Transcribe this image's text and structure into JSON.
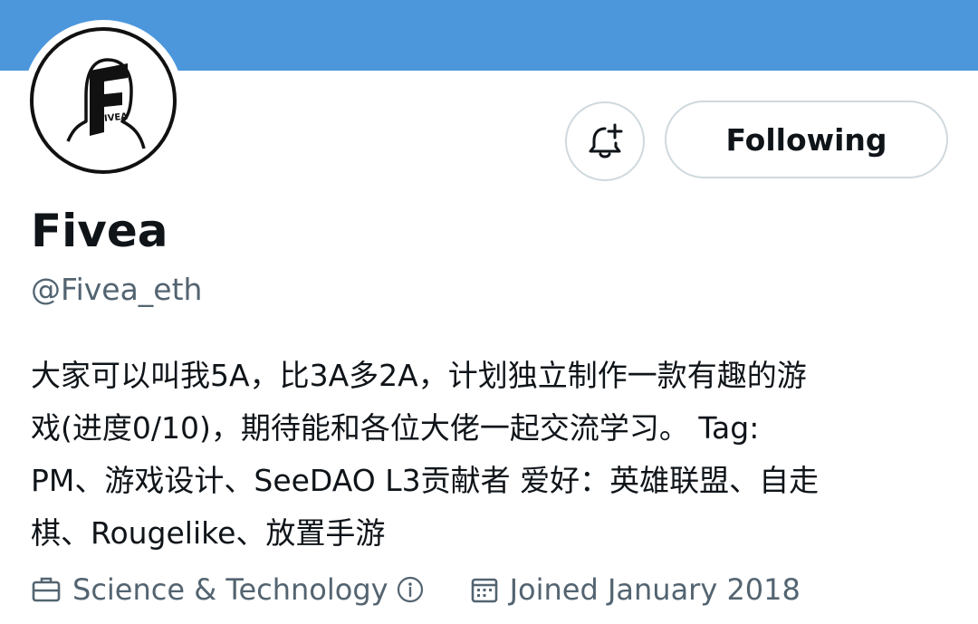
{
  "profile": {
    "display_name": "Fivea",
    "handle": "@Fivea_eth",
    "bio_lines": [
      "大家可以叫我5A，比3A多2A，计划独立制作一款有趣的游",
      "戏(进度0/10)，期待能和各位大佬一起交流学习。 Tag:",
      "PM、游戏设计、SeeDAO L3贡献者 爱好：英雄联盟、自走",
      "棋、Rougelike、放置手游"
    ],
    "category": "Science & Technology",
    "joined": "Joined January 2018",
    "avatar_text": "IVEA"
  },
  "actions": {
    "follow_label": "Following",
    "notify_icon": "bell-plus-icon"
  },
  "icons": {
    "category": "briefcase-icon",
    "info": "info-circle-icon",
    "joined": "calendar-icon"
  },
  "colors": {
    "banner": "#4c97dc",
    "secondary_text": "#536471",
    "primary_text": "#0f1419",
    "button_border": "#cfd9de"
  }
}
